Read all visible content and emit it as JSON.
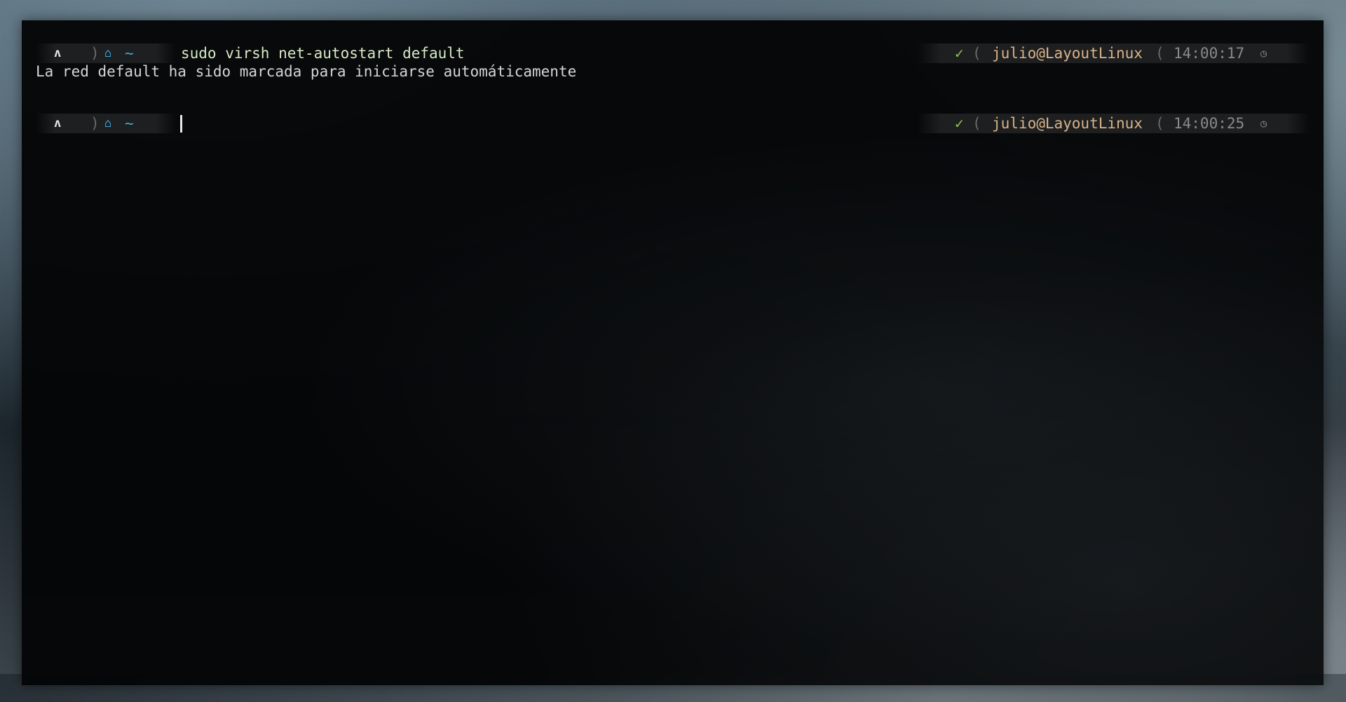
{
  "terminal": {
    "lines": [
      {
        "prompt": {
          "os_icon": "ʌ",
          "separator": ")",
          "home_icon": "⌂",
          "cwd": "~"
        },
        "command": "sudo virsh net-autostart default",
        "right_prompt": {
          "status_icon": "✓",
          "open_sep": "(",
          "user_host": "julio@LayoutLinux",
          "close_sep": "(",
          "time": "14:00:17",
          "clock_icon": "◷"
        }
      },
      {
        "output": "La red default ha sido marcada para iniciarse automáticamente"
      },
      {
        "prompt": {
          "os_icon": "ʌ",
          "separator": ")",
          "home_icon": "⌂",
          "cwd": "~"
        },
        "command": "",
        "right_prompt": {
          "status_icon": "✓",
          "open_sep": "(",
          "user_host": "julio@LayoutLinux",
          "close_sep": "(",
          "time": "14:00:25",
          "clock_icon": "◷"
        }
      }
    ]
  },
  "colors": {
    "terminal_bg": "#050607",
    "command": "#d7e9c5",
    "output": "#d5d5d5",
    "accent_blue": "#3fa7e0",
    "status_ok": "#8cc34a",
    "user_host": "#d9b48a",
    "time": "#8a8a8a"
  },
  "icons": {
    "os": "arch-linux-icon",
    "home": "home-icon",
    "status": "checkmark-icon",
    "clock": "clock-icon"
  }
}
